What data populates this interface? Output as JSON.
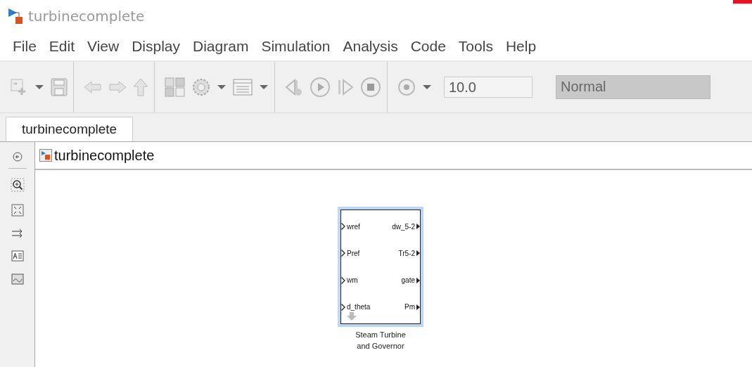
{
  "window": {
    "title": "turbinecomplete"
  },
  "menu": [
    "File",
    "Edit",
    "View",
    "Display",
    "Diagram",
    "Simulation",
    "Analysis",
    "Code",
    "Tools",
    "Help"
  ],
  "toolbar": {
    "stop_time": "10.0",
    "mode": "Normal"
  },
  "tabs": [
    {
      "label": "turbinecomplete",
      "selected": true
    }
  ],
  "breadcrumb": "turbinecomplete",
  "block": {
    "name_lines": [
      "Steam Turbine",
      "and Governor"
    ],
    "selected": true,
    "inputs": [
      "wref",
      "Pref",
      "wm",
      "d_theta"
    ],
    "outputs": [
      "dw_5-2",
      "Tr5-2",
      "gate",
      "Pm"
    ]
  }
}
